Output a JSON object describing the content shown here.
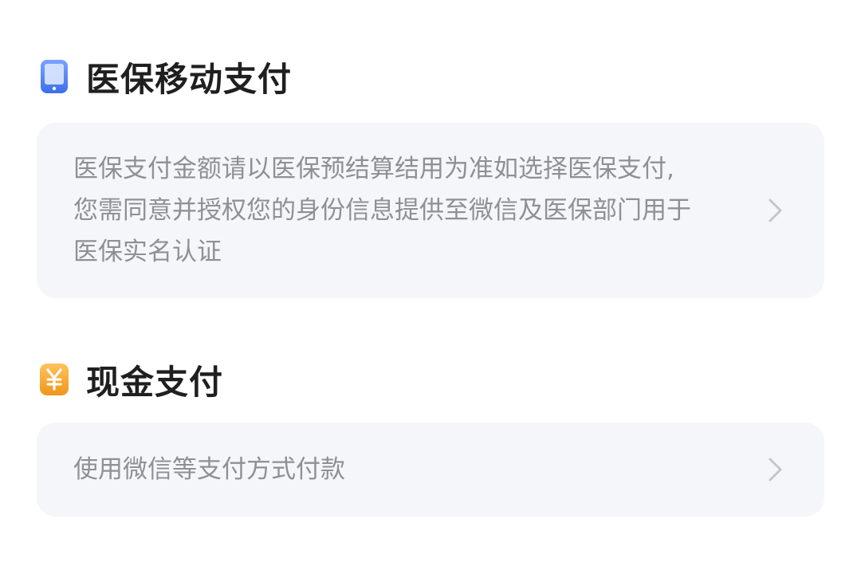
{
  "medical_payment": {
    "title": "医保移动支付",
    "icon": "phone-icon",
    "icon_color": "#4a7cf0",
    "description_lines": [
      "医保支付金额请以医保预结算结用为准如选择医保支付,",
      "您需同意并授权您的身份信息提供至微信及医保部门用于",
      "医保实名认证"
    ]
  },
  "cash_payment": {
    "title": "现金支付",
    "icon": "yen-icon",
    "icon_color": "#f5a623",
    "description": "使用微信等支付方式付款"
  },
  "colors": {
    "card_background": "#f5f6fa",
    "title_text": "#1f1f1f",
    "desc_text": "#8e9095",
    "chevron": "#c4c6cc"
  }
}
